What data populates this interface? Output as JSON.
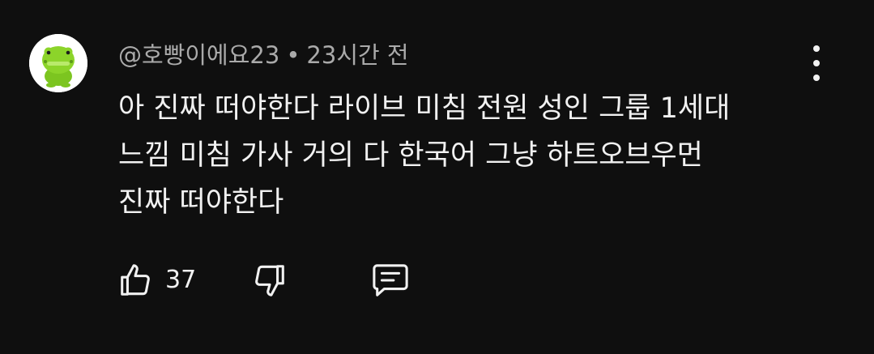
{
  "comment": {
    "author": "@호빵이에요23",
    "separator": "•",
    "time": "23시간 전",
    "lines": [
      "아 진짜 떠야한다 라이브 미침 전원 성인 그룹 1세대",
      "느낌 미침 가사 거의 다 한국어 그냥 하트오브우먼",
      "진짜 떠야한다"
    ],
    "like_count": "37"
  },
  "icons": {
    "avatar": "green-frog-character-avatar",
    "menu": "more-vert-icon",
    "like": "thumb-up-icon",
    "dislike": "thumb-down-icon",
    "reply": "reply-comment-icon"
  },
  "colors": {
    "background": "#0f0f0f",
    "text_primary": "#f1f1f1",
    "text_secondary": "#aaaaaa",
    "avatar_green": "#7cc520"
  }
}
